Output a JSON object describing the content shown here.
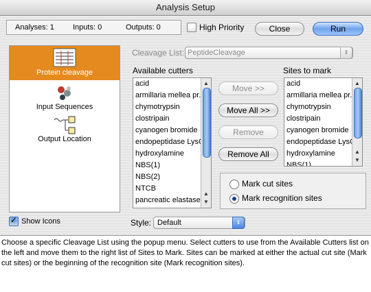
{
  "window": {
    "title": "Analysis Setup"
  },
  "counts": {
    "analyses": "Analyses: 1",
    "inputs": "Inputs: 0",
    "outputs": "Outputs: 0"
  },
  "high_priority": {
    "label": "High Priority",
    "checked": false
  },
  "buttons": {
    "close": "Close",
    "run": "Run"
  },
  "sidebar": {
    "items": [
      {
        "label": "Protein cleavage",
        "icon": "protein-cleavage-icon",
        "selected": true
      },
      {
        "label": "Input Sequences",
        "icon": "input-sequences-icon",
        "selected": false
      },
      {
        "label": "Output Location",
        "icon": "output-location-icon",
        "selected": false
      }
    ]
  },
  "cleavage_list": {
    "label": "Cleavage List:",
    "value": "PeptideCleavage"
  },
  "available": {
    "heading": "Available cutters",
    "items": [
      "acid",
      "armillaria mellea pr...",
      "chymotrypsin",
      "clostripain",
      "cyanogen bromide",
      "endopeptidase LysC",
      "hydroxylamine",
      "NBS(1)",
      "NBS(2)",
      "NTCB",
      "pancreatic elastase"
    ]
  },
  "sites": {
    "heading": "Sites to mark",
    "items": [
      "acid",
      "armillaria mellea pr...",
      "chymotrypsin",
      "clostripain",
      "cyanogen bromide",
      "endopeptidase LysC",
      "hydroxylamine",
      "NBS(1)"
    ]
  },
  "move_buttons": {
    "move": "Move >>",
    "move_all": "Move All >>",
    "remove": "Remove",
    "remove_all": "Remove All"
  },
  "mark_options": {
    "cut_sites": "Mark cut sites",
    "recognition_sites": "Mark recognition sites",
    "selected": "recognition_sites"
  },
  "show_icons": {
    "label": "Show Icons",
    "checked": true
  },
  "style": {
    "label": "Style:",
    "value": "Default"
  },
  "help_text": "Choose a specific Cleavage List using the popup menu. Select cutters to use from the Available Cutters list on the left and move them to the right list of Sites to Mark. Sites can be marked at either the actual cut site (Mark cut sites) or the beginning of the recognition site (Mark recognition sites)."
}
